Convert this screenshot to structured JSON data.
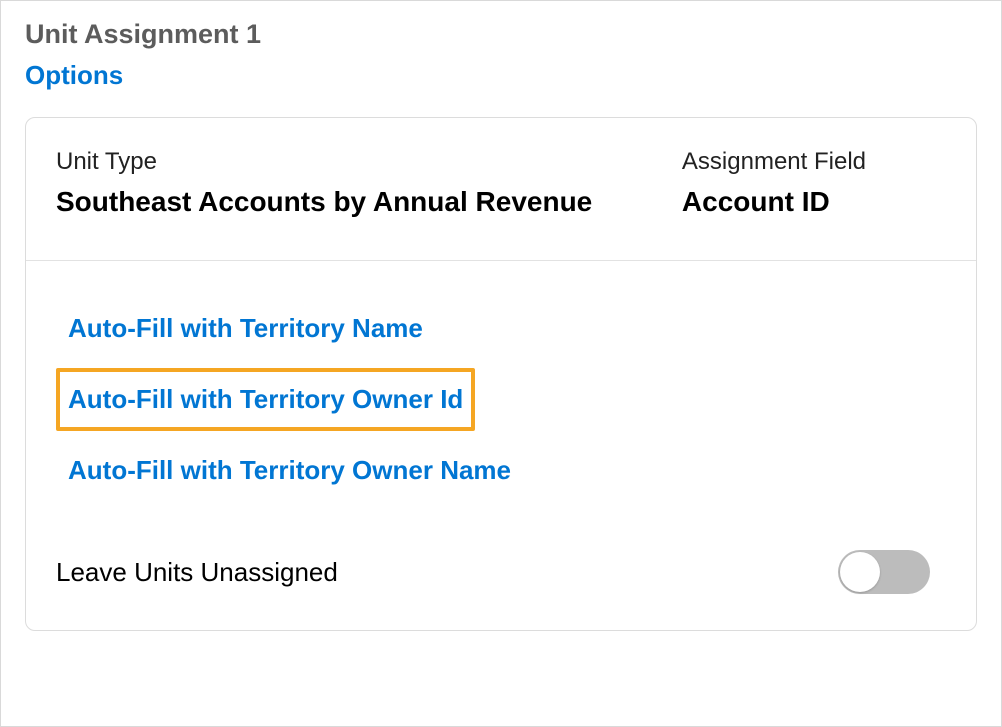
{
  "header": {
    "title": "Unit Assignment 1",
    "options_label": "Options"
  },
  "card": {
    "unit_type_label": "Unit Type",
    "unit_type_value": "Southeast Accounts by Annual Revenue",
    "assignment_field_label": "Assignment Field",
    "assignment_field_value": "Account ID"
  },
  "options": {
    "items": [
      {
        "label": "Auto-Fill with Territory Name",
        "highlighted": false
      },
      {
        "label": "Auto-Fill with Territory Owner Id",
        "highlighted": true
      },
      {
        "label": "Auto-Fill with Territory Owner Name",
        "highlighted": false
      }
    ]
  },
  "toggle": {
    "label": "Leave Units Unassigned",
    "state": "off"
  }
}
